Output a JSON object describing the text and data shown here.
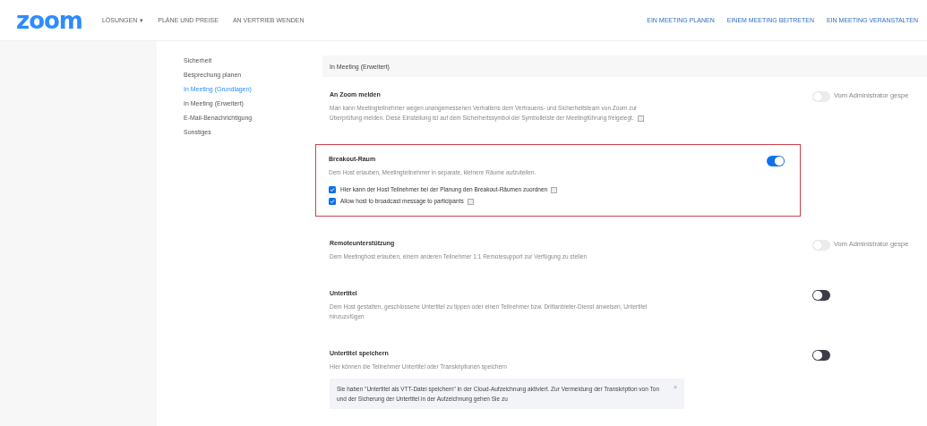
{
  "header": {
    "logo": "zoom",
    "nav": [
      {
        "label": "LÖSUNGEN",
        "caret": "▾"
      },
      {
        "label": "PLÄNE UND PREISE"
      },
      {
        "label": "AN VERTRIEB WENDEN"
      }
    ],
    "actions": [
      "EIN MEETING PLANEN",
      "EINEM MEETING BEITRETEN",
      "EIN MEETING VERANSTALTEN"
    ]
  },
  "sidebar": {
    "items": [
      {
        "label": "Sicherheit",
        "selected": false
      },
      {
        "label": "Besprechung planen",
        "selected": false
      },
      {
        "label": "In Meeting (Grundlagen)",
        "selected": true
      },
      {
        "label": "In Meeting (Erweitert)",
        "selected": false
      },
      {
        "label": "E-Mail-Benachrichtigung",
        "selected": false
      },
      {
        "label": "Sonstiges",
        "selected": false
      }
    ]
  },
  "section": {
    "title": "In Meeting (Erweitert)"
  },
  "settings": [
    {
      "title": "An Zoom melden",
      "description": "Man kann Meetingteilnehmer wegen unangemessenen Verhaltens dem Vertrauens- und Sicherheitsteam von Zoom zur Überprüfung melden. Diese Einstellung ist auf dem Sicherheitssymbol der Symbolleiste der Meetingführung freigelegt.",
      "info": true,
      "highlighted": false,
      "on": false,
      "note": "Vom Administrator gespe"
    },
    {
      "title": "Breakout-Raum",
      "description": "Dem Host erlauben, Meetingteilnehmer in separate, kleinere Räume aufzuteilen.",
      "info": false,
      "highlighted": true,
      "on": true,
      "options": [
        {
          "label": "Hier kann der Host Teilnehmer bei der Planung den Breakout-Räumen zuordnen",
          "checked": true,
          "info": true
        },
        {
          "label": "Allow host to broadcast message to participants",
          "checked": true,
          "info": true
        }
      ]
    },
    {
      "title": "Remoteunterstützung",
      "description": "Dem Meetinghost erlauben, einem anderen Teilnehmer 1:1 Remotesupport zur Verfügung zu stellen",
      "info": false,
      "highlighted": false,
      "on": false,
      "note": "Vom Administrator gespe"
    },
    {
      "title": "Untertitel",
      "description": "Dem Host gestatten, geschlossene Untertitel zu tippen oder einen Teilnehmer bzw. Drittanbieter-Dienst anweisen, Untertitel hinzuzufügen",
      "info": false,
      "highlighted": false,
      "on": false
    },
    {
      "title": "Untertitel speichern",
      "description": "Hier können die Teilnehmer Untertitel oder Transkriptionen speichern",
      "info": false,
      "highlighted": false,
      "on": false,
      "notice": {
        "close": "×",
        "text": "Sie haben \"Untertitel als VTT-Datei speichern\" in der Cloud-Aufzeichnung aktiviert. Zur Vermeidung der Transkription von Ton und der Sicherung der Untertitel in der Aufzeichnung gehen Sie zu"
      }
    }
  ]
}
